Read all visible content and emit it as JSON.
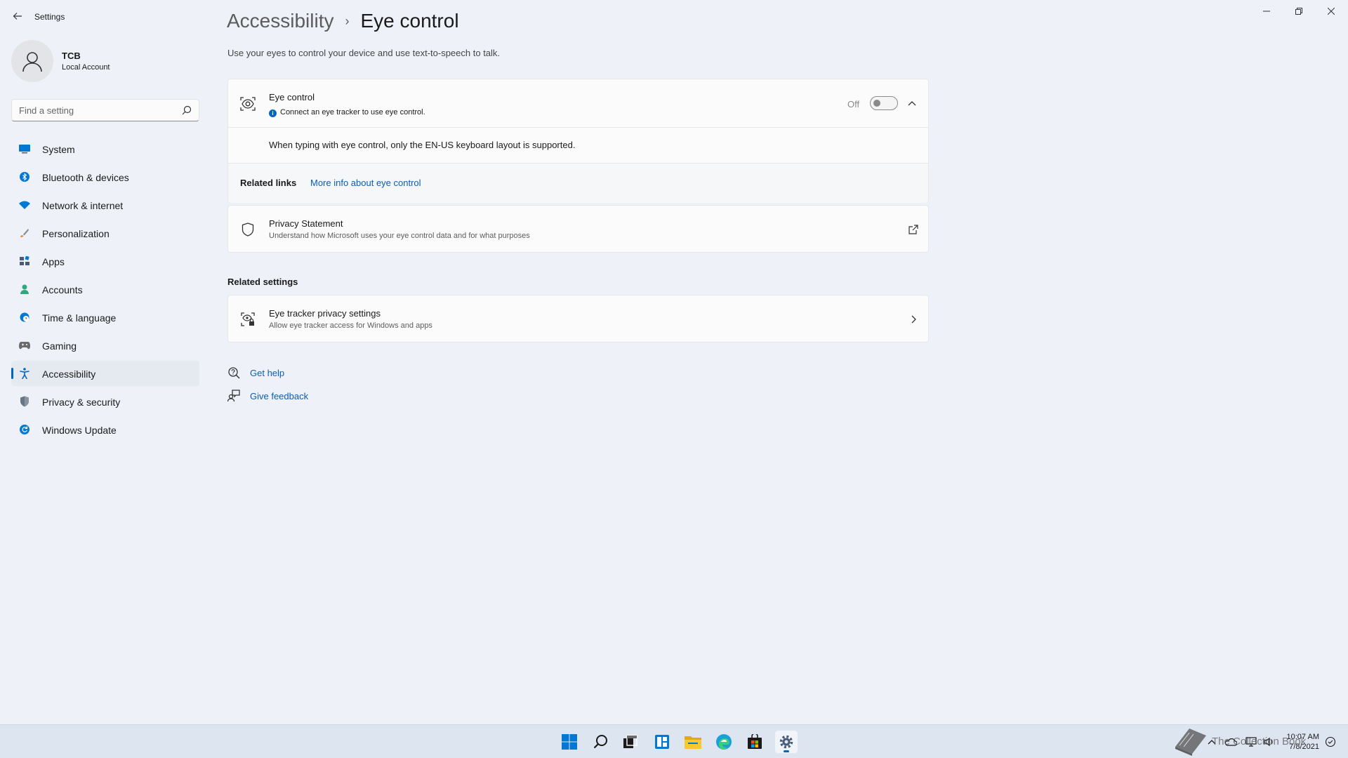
{
  "window": {
    "title": "Settings",
    "controls": [
      "minimize",
      "restore",
      "close"
    ]
  },
  "profile": {
    "name": "TCB",
    "account_type": "Local Account"
  },
  "search": {
    "placeholder": "Find a setting"
  },
  "sidebar": {
    "items": [
      {
        "label": "System",
        "icon": "system-icon",
        "color": "#0078d4"
      },
      {
        "label": "Bluetooth & devices",
        "icon": "bluetooth-icon",
        "color": "#0078d4"
      },
      {
        "label": "Network & internet",
        "icon": "wifi-icon",
        "color": "#0078d4"
      },
      {
        "label": "Personalization",
        "icon": "brush-icon",
        "color": "#e08b3a"
      },
      {
        "label": "Apps",
        "icon": "apps-icon",
        "color": "#4a5b7a"
      },
      {
        "label": "Accounts",
        "icon": "person-icon",
        "color": "#2ea97d"
      },
      {
        "label": "Time & language",
        "icon": "globe-clock-icon",
        "color": "#0078d4"
      },
      {
        "label": "Gaming",
        "icon": "gamepad-icon",
        "color": "#6b6b6b"
      },
      {
        "label": "Accessibility",
        "icon": "accessibility-icon",
        "color": "#0067c0",
        "active": true
      },
      {
        "label": "Privacy & security",
        "icon": "shield-icon",
        "color": "#6b7484"
      },
      {
        "label": "Windows Update",
        "icon": "update-icon",
        "color": "#0078d4"
      }
    ]
  },
  "header": {
    "parent": "Accessibility",
    "separator": "›",
    "current": "Eye control",
    "description": "Use your eyes to control your device and use text-to-speech to talk."
  },
  "eye_control": {
    "title": "Eye control",
    "info": "Connect an eye tracker to use eye control.",
    "toggle_label": "Off",
    "toggle_on": false,
    "expanded": true,
    "body_text": "When typing with eye control, only the EN-US keyboard layout is supported.",
    "related_links_label": "Related links",
    "related_link": "More info about eye control"
  },
  "privacy_statement": {
    "title": "Privacy Statement",
    "subtitle": "Understand how Microsoft uses your eye control data and for what purposes"
  },
  "related_settings": {
    "heading": "Related settings",
    "items": [
      {
        "title": "Eye tracker privacy settings",
        "subtitle": "Allow eye tracker access for Windows and apps"
      }
    ]
  },
  "help": {
    "get_help": "Get help",
    "give_feedback": "Give feedback"
  },
  "taskbar": {
    "apps": [
      "start-icon",
      "search-icon",
      "task-view-icon",
      "widgets-icon",
      "file-explorer-icon",
      "edge-icon",
      "store-icon",
      "settings-icon"
    ],
    "active_app": "settings-icon",
    "time": "10:07 AM",
    "date": "7/8/2021"
  },
  "watermark": {
    "text": "The Collection Book"
  },
  "colors": {
    "accent": "#0067c0",
    "link": "#0a5db6",
    "background": "#eef2f8",
    "card": "#fbfbfc"
  }
}
